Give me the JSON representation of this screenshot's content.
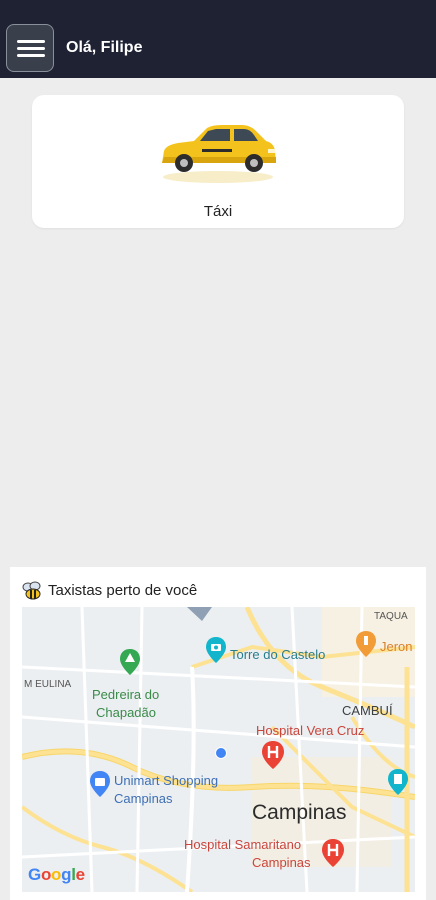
{
  "header": {
    "greeting": "Olá, Filipe",
    "background": "#1e2233"
  },
  "service": {
    "label": "Táxi",
    "icon": "taxi-car-icon"
  },
  "map_section": {
    "title": "Taxistas perto de você",
    "icon": "bee-icon",
    "labels": {
      "taquaral": "TAQUA",
      "jeronimo": "Jeron",
      "torre": "Torre do Castelo",
      "eulina": "M EULINA",
      "pedreira_1": "Pedreira do",
      "pedreira_2": "Chapadão",
      "cambui": "CAMBUÍ",
      "vera_cruz": "Hospital Vera Cruz",
      "unimart_1": "Unimart Shopping",
      "unimart_2": "Campinas",
      "city": "Campinas",
      "samaritano_1": "Hospital Samaritano",
      "samaritano_2": "Campinas"
    },
    "logo": [
      "G",
      "o",
      "o",
      "g",
      "l",
      "e"
    ]
  },
  "colors": {
    "accent_taxi": "#f4c21d",
    "map_green": "#3a8a4a",
    "map_red": "#c9453c",
    "map_blue": "#4285f4"
  }
}
